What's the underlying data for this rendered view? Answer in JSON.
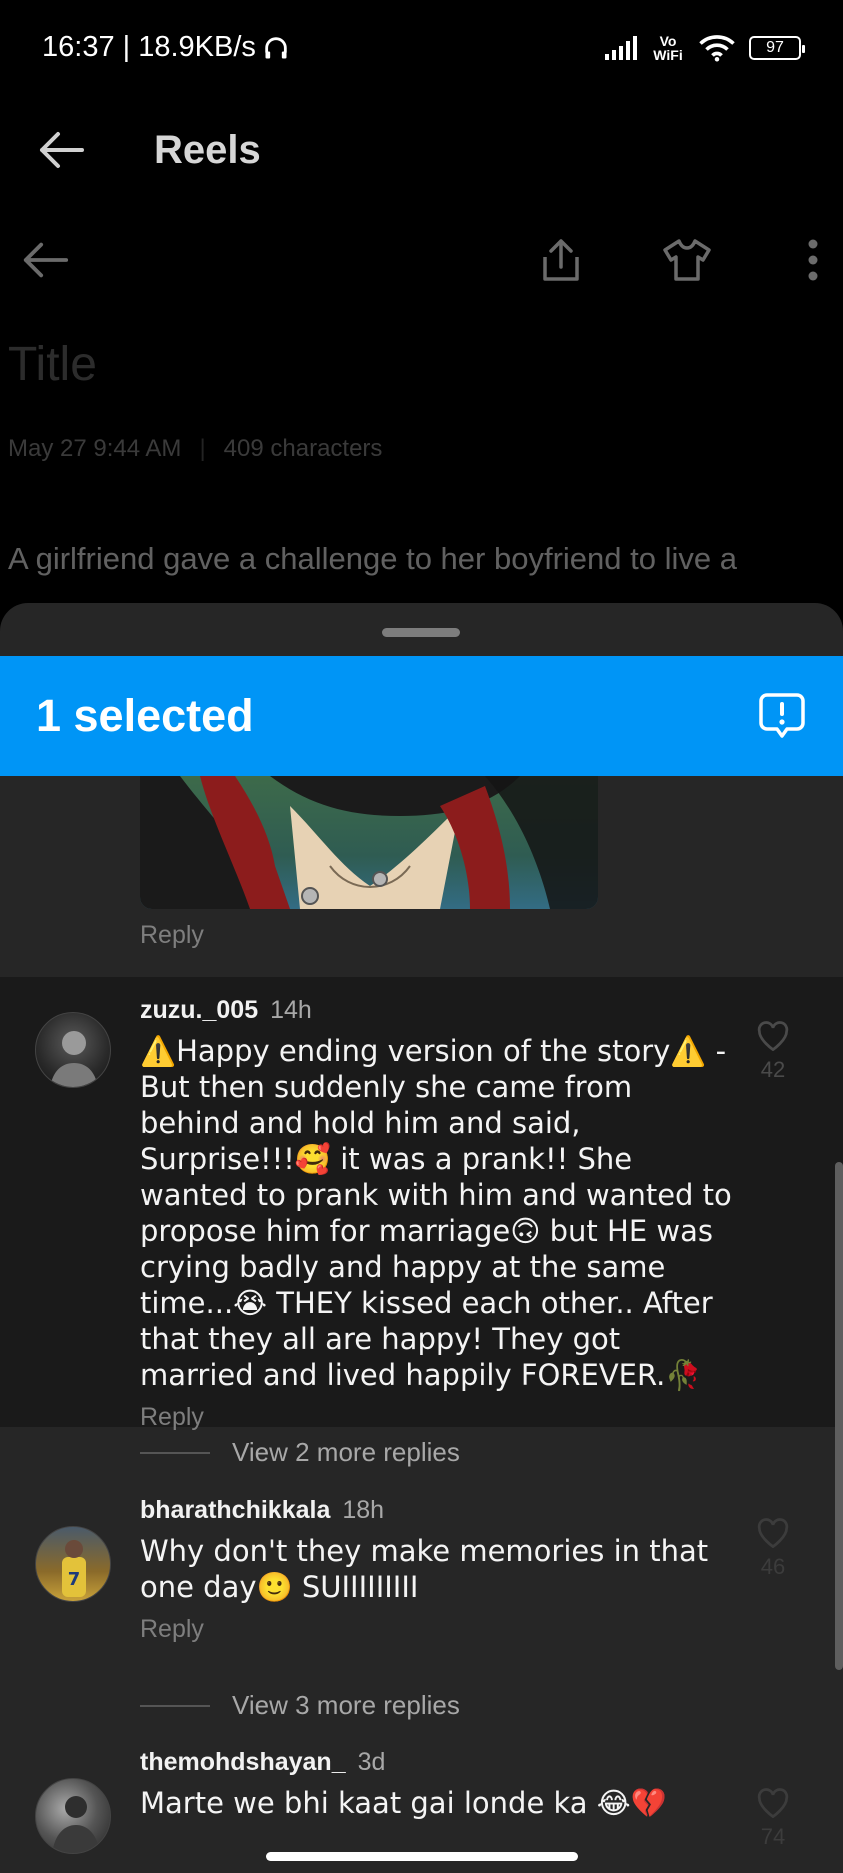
{
  "status_bar": {
    "time_speed": "16:37 | 18.9KB/s",
    "network": "Vo WiFi",
    "battery": "97"
  },
  "app_bar": {
    "title": "Reels"
  },
  "note": {
    "title": "Title",
    "date": "May 27  9:44 AM",
    "chars": "409 characters",
    "body": "A girlfriend gave a challenge to her boyfriend to live a"
  },
  "selection_bar": {
    "label": "1 selected"
  },
  "comments": [
    {
      "reply_label": "Reply"
    },
    {
      "username": "zuzu._005",
      "time": "14h",
      "text": "⚠️Happy ending version of the story⚠️ - But then suddenly she came from behind and hold him and said, Surprise!!!🥰 it was a prank!! She wanted to prank with him and wanted to propose him for marriage🙃 but HE was crying badly and happy at the same time...😭 THEY kissed each other.. After that they all are happy! They got married and lived happily FOREVER.🥀",
      "likes": "42",
      "reply_label": "Reply"
    },
    {
      "username": "bharathchikkala",
      "time": "18h",
      "text": "Why don't they make memories in that one day🙂 SUIIIIIIIII",
      "likes": "46",
      "reply_label": "Reply"
    },
    {
      "username": "themohdshayan_",
      "time": "3d",
      "text": "Marte we bhi  kaat gai londe  ka 😂💔",
      "likes": "74"
    }
  ],
  "more_replies": [
    "View 2 more replies",
    "View 3 more replies"
  ],
  "colors": {
    "accent": "#0095f6",
    "sheet": "#262626",
    "selected_row": "#1a1a1a"
  }
}
